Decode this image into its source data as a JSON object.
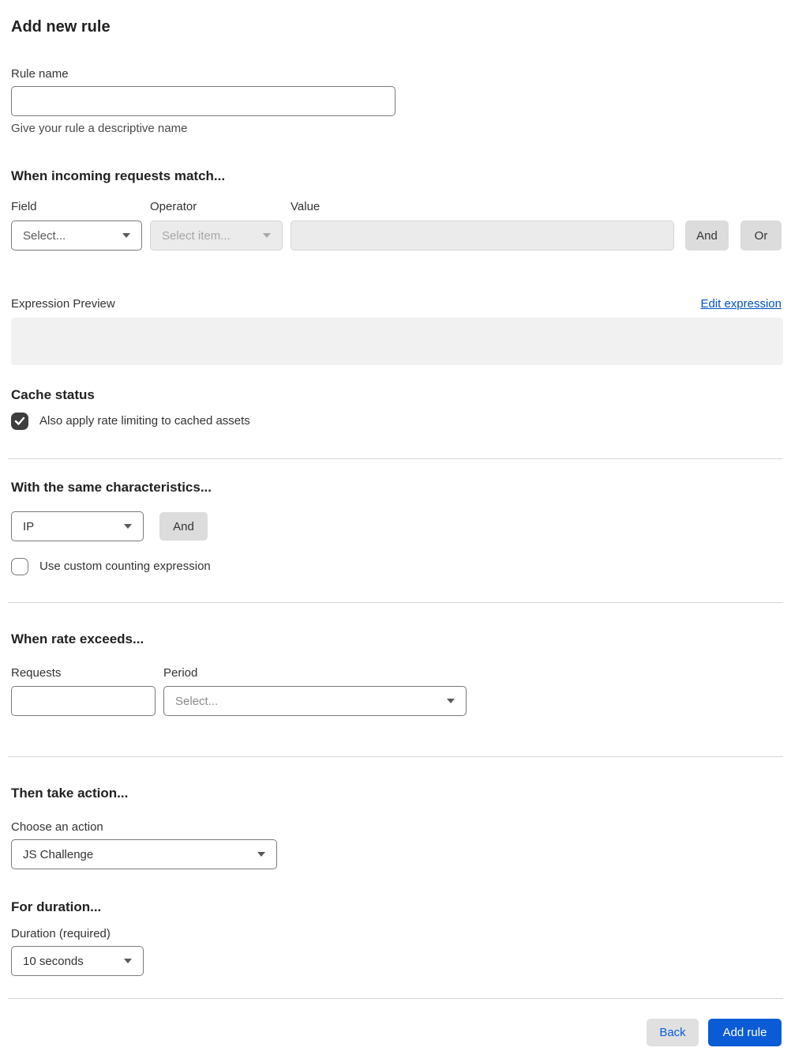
{
  "page": {
    "title": "Add new rule"
  },
  "rule_name": {
    "label": "Rule name",
    "value": "",
    "helper": "Give your rule a descriptive name"
  },
  "match_section": {
    "heading": "When incoming requests match...",
    "field": {
      "label": "Field",
      "placeholder": "Select..."
    },
    "operator": {
      "label": "Operator",
      "placeholder": "Select item...",
      "disabled": true
    },
    "value": {
      "label": "Value",
      "value": "",
      "disabled": true
    },
    "and_button": "And",
    "or_button": "Or",
    "expression_preview_label": "Expression Preview",
    "edit_expression_link": "Edit expression",
    "expression_value": ""
  },
  "cache_status": {
    "heading": "Cache status",
    "checkbox_label": "Also apply rate limiting to cached assets",
    "checked": true
  },
  "characteristics": {
    "heading": "With the same characteristics...",
    "selected": "IP",
    "and_button": "And",
    "custom_counting_label": "Use custom counting expression",
    "custom_counting_checked": false
  },
  "rate": {
    "heading": "When rate exceeds...",
    "requests_label": "Requests",
    "requests_value": "",
    "period_label": "Period",
    "period_placeholder": "Select..."
  },
  "action": {
    "heading": "Then take action...",
    "label": "Choose an action",
    "selected": "JS Challenge"
  },
  "duration": {
    "heading": "For duration...",
    "label": "Duration (required)",
    "selected": "10 seconds"
  },
  "footer": {
    "back_label": "Back",
    "add_rule_label": "Add rule"
  },
  "colors": {
    "primary_blue": "#0a5cd6",
    "link_blue": "#0051c3",
    "checkbox_dark": "#3d3d3d",
    "disabled_bg": "#ebebeb",
    "gray_button": "#dcdcdc"
  }
}
